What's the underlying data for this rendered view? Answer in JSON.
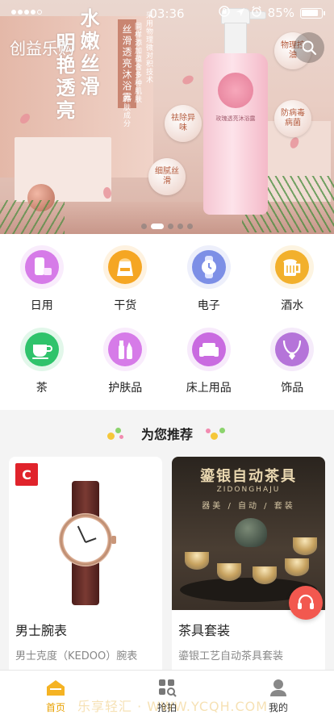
{
  "status": {
    "time": "03:36",
    "battery": "85%"
  },
  "banner": {
    "brand": "创益乐购",
    "headline1": "水嫩丝滑",
    "headline2": "明艳透亮",
    "product_tag": "丝滑透亮沐浴露",
    "desc1": "采用物理微对积技术",
    "desc2": "同样添加蕴含多种肌肤",
    "desc3": "养肤成分",
    "bubbles": [
      "物理控油",
      "祛除异味",
      "防病毒病菌",
      "细腻丝滑"
    ],
    "bottle_label": "玫瑰透亮沐浴露",
    "slides": 5,
    "active_slide": 2
  },
  "categories": [
    {
      "label": "日用",
      "icon": "daily-goods-icon",
      "bg": "#d67be8"
    },
    {
      "label": "干货",
      "icon": "dry-goods-bag-icon",
      "bg": "#f5a623"
    },
    {
      "label": "电子",
      "icon": "watch-electronics-icon",
      "bg": "#7d8fe6"
    },
    {
      "label": "酒水",
      "icon": "beer-mug-icon",
      "bg": "#f2b02c"
    },
    {
      "label": "茶",
      "icon": "tea-cup-icon",
      "bg": "#2fc36b"
    },
    {
      "label": "护肤品",
      "icon": "skincare-icon",
      "bg": "#d67be8"
    },
    {
      "label": "床上用品",
      "icon": "sofa-icon",
      "bg": "#c96be0"
    },
    {
      "label": "饰品",
      "icon": "necklace-icon",
      "bg": "#b574d9"
    }
  ],
  "recommend": {
    "title": "为您推荐"
  },
  "products": [
    {
      "name": "男士腕表",
      "desc": "男士克度（KEDOO）腕表"
    },
    {
      "name": "茶具套装",
      "desc": "鎏银工艺自动茶具套装",
      "img_title": "鎏银自动茶具",
      "img_sub": "ZIDONGHAJU",
      "img_tagline": "器美 / 自动 / 套装"
    }
  ],
  "tabs": [
    {
      "label": "首页",
      "active": true
    },
    {
      "label": "抢拍",
      "active": false
    },
    {
      "label": "我的",
      "active": false
    }
  ],
  "watermark": "乐享轻汇 · WWW.YCQH.COM"
}
